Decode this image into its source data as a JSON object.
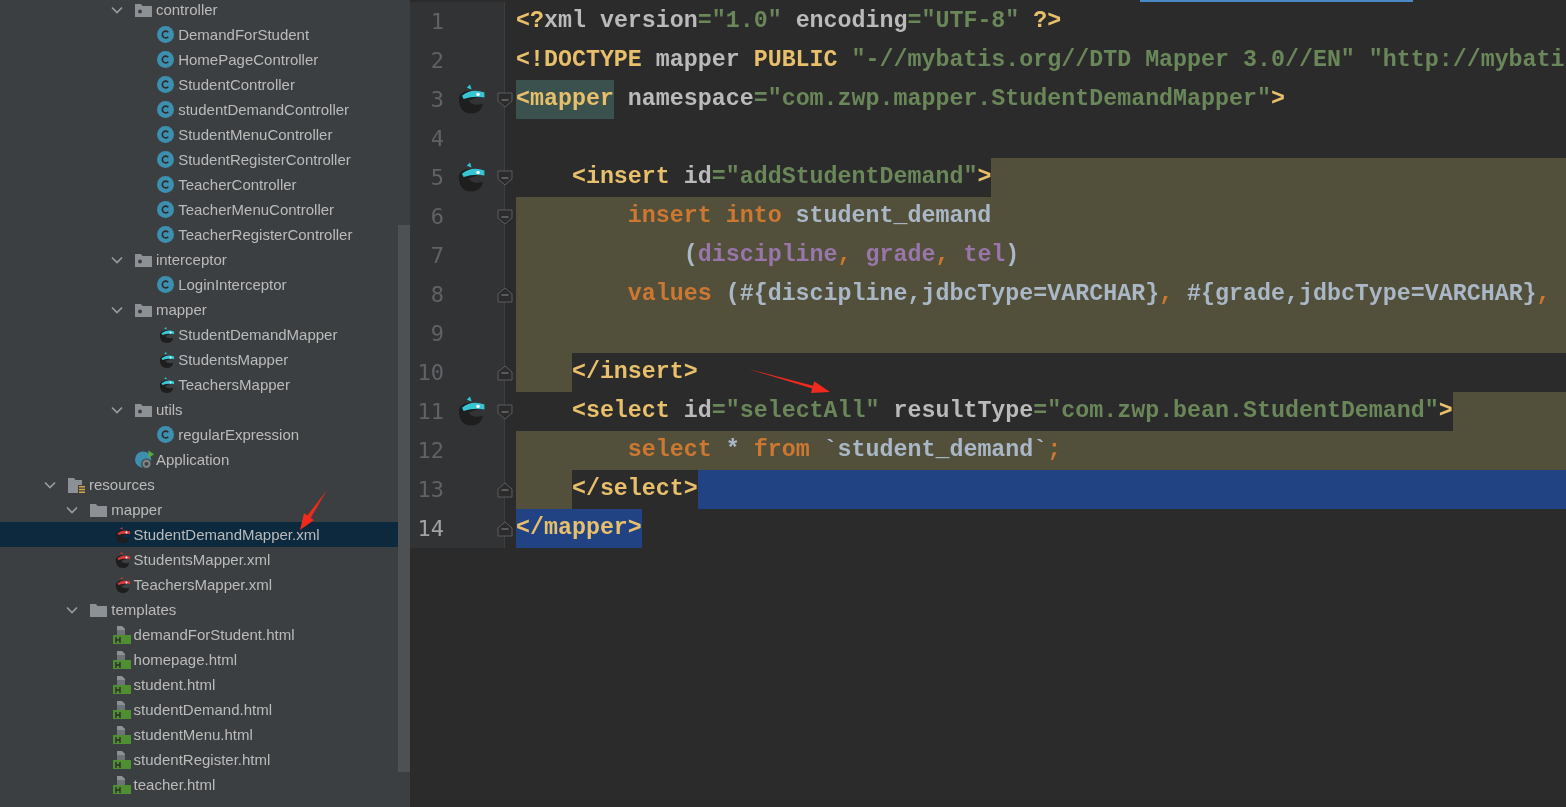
{
  "project_tree": [
    {
      "children": [
        {
          "children": [
            {
              "children": [
                {
                  "label": "controller",
                  "kind": "package",
                  "expanded": true,
                  "selected": false,
                  "children": [
                    {
                      "label": "DemandForStudent",
                      "kind": "class",
                      "selected": false
                    },
                    {
                      "label": "HomePageController",
                      "kind": "class",
                      "selected": false
                    },
                    {
                      "label": "StudentController",
                      "kind": "class",
                      "selected": false
                    },
                    {
                      "label": "studentDemandController",
                      "kind": "class",
                      "selected": false
                    },
                    {
                      "label": "StudentMenuController",
                      "kind": "class",
                      "selected": false
                    },
                    {
                      "label": "StudentRegisterController",
                      "kind": "class",
                      "selected": false
                    },
                    {
                      "label": "TeacherController",
                      "kind": "class",
                      "selected": false
                    },
                    {
                      "label": "TeacherMenuController",
                      "kind": "class",
                      "selected": false
                    },
                    {
                      "label": "TeacherRegisterController",
                      "kind": "class",
                      "selected": false
                    }
                  ]
                },
                {
                  "label": "interceptor",
                  "kind": "package",
                  "expanded": true,
                  "selected": false,
                  "children": [
                    {
                      "label": "LoginInterceptor",
                      "kind": "class",
                      "selected": false
                    }
                  ]
                },
                {
                  "label": "mapper",
                  "kind": "package",
                  "expanded": true,
                  "selected": false,
                  "children": [
                    {
                      "label": "StudentDemandMapper",
                      "kind": "mapper",
                      "selected": false
                    },
                    {
                      "label": "StudentsMapper",
                      "kind": "mapper",
                      "selected": false
                    },
                    {
                      "label": "TeachersMapper",
                      "kind": "mapper",
                      "selected": false
                    }
                  ]
                },
                {
                  "label": "utils",
                  "kind": "package",
                  "expanded": true,
                  "selected": false,
                  "children": [
                    {
                      "label": "regularExpression",
                      "kind": "class",
                      "selected": false
                    }
                  ]
                },
                {
                  "label": "Application",
                  "kind": "app",
                  "selected": false
                }
              ]
            }
          ]
        }
      ]
    },
    {
      "label": "resources",
      "kind": "resources",
      "expanded": true,
      "selected": false,
      "children": [
        {
          "label": "mapper",
          "kind": "folder",
          "expanded": true,
          "selected": false,
          "children": [
            {
              "label": "StudentDemandMapper.xml",
              "kind": "mapper_xml",
              "selected": true
            },
            {
              "label": "StudentsMapper.xml",
              "kind": "mapper_xml",
              "selected": false
            },
            {
              "label": "TeachersMapper.xml",
              "kind": "mapper_xml",
              "selected": false
            }
          ]
        },
        {
          "label": "templates",
          "kind": "folder",
          "expanded": true,
          "selected": false,
          "children": [
            {
              "label": "demandForStudent.html",
              "kind": "html",
              "selected": false
            },
            {
              "label": "homepage.html",
              "kind": "html",
              "selected": false
            },
            {
              "label": "student.html",
              "kind": "html",
              "selected": false
            },
            {
              "label": "studentDemand.html",
              "kind": "html",
              "selected": false
            },
            {
              "label": "studentMenu.html",
              "kind": "html",
              "selected": false
            },
            {
              "label": "studentRegister.html",
              "kind": "html",
              "selected": false
            },
            {
              "label": "teacher.html",
              "kind": "html",
              "selected": false
            }
          ]
        }
      ]
    }
  ],
  "code_lines": [
    {
      "number": "1",
      "current": false,
      "tokens": [
        {
          "text": "<?",
          "kind": "tag"
        },
        {
          "text": "xml",
          "kind": "attr"
        },
        {
          "text": " version",
          "kind": "attr"
        },
        {
          "text": "=\"1.0\"",
          "kind": "string"
        },
        {
          "text": " encoding",
          "kind": "attr"
        },
        {
          "text": "=\"UTF-8\"",
          "kind": "string"
        },
        {
          "text": " ?>",
          "kind": "tag"
        }
      ]
    },
    {
      "number": "2",
      "current": false,
      "tokens": [
        {
          "text": "<!DOCTYPE",
          "kind": "tag"
        },
        {
          "text": " mapper ",
          "kind": "attr"
        },
        {
          "text": "PUBLIC",
          "kind": "tag"
        },
        {
          "text": " \"-//mybatis.org//DTD Mapper 3.0//EN\" \"http://mybati",
          "kind": "string"
        }
      ]
    },
    {
      "number": "3",
      "mapper_icon": true,
      "fold_start": true,
      "current": false,
      "tokens": [
        {
          "text": "<mapper",
          "kind": "tag",
          "match": true
        },
        {
          "text": " namespace",
          "kind": "attr"
        },
        {
          "text": "=\"com.zwp.mapper.StudentDemandMapper\"",
          "kind": "string"
        },
        {
          "text": ">",
          "kind": "tag"
        }
      ]
    },
    {
      "number": "4",
      "current": false
    },
    {
      "number": "5",
      "mapper_icon": true,
      "fold_start": true,
      "current": false,
      "fill_highlight": true,
      "tokens": [
        {
          "text": "    <insert",
          "kind": "tag"
        },
        {
          "text": " id",
          "kind": "attr"
        },
        {
          "text": "=\"addStudentDemand\"",
          "kind": "string"
        },
        {
          "text": ">",
          "kind": "tag"
        }
      ]
    },
    {
      "number": "6",
      "fold_start": true,
      "current": false,
      "fill_highlight": true,
      "indent_highlight": true,
      "tokens": [
        {
          "text": "        insert into ",
          "kind": "keyword",
          "highlight": true
        },
        {
          "text": "student_demand",
          "kind": "plain",
          "highlight": true
        }
      ]
    },
    {
      "number": "7",
      "current": false,
      "fill_highlight": true,
      "indent_highlight": true,
      "tokens": [
        {
          "text": "            (",
          "kind": "plain",
          "highlight": true
        },
        {
          "text": "discipline",
          "kind": "column",
          "highlight": true
        },
        {
          "text": ", ",
          "kind": "keyword",
          "highlight": true
        },
        {
          "text": "grade",
          "kind": "column",
          "highlight": true
        },
        {
          "text": ", ",
          "kind": "keyword",
          "highlight": true
        },
        {
          "text": "tel",
          "kind": "column",
          "highlight": true
        },
        {
          "text": ")",
          "kind": "plain",
          "highlight": true
        }
      ]
    },
    {
      "number": "8",
      "fold_end": true,
      "current": false,
      "fill_highlight": true,
      "indent_highlight": true,
      "tokens": [
        {
          "text": "        values ",
          "kind": "keyword",
          "highlight": true
        },
        {
          "text": "(#{discipline,jdbcType=VARCHAR}",
          "kind": "plain",
          "highlight": true
        },
        {
          "text": ", ",
          "kind": "keyword",
          "highlight": true
        },
        {
          "text": "#{grade,jdbcType=VARCHAR}",
          "kind": "plain",
          "highlight": true
        },
        {
          "text": ",",
          "kind": "keyword",
          "highlight": true
        }
      ]
    },
    {
      "number": "9",
      "current": false,
      "fill_highlight": true
    },
    {
      "number": "10",
      "fold_end": true,
      "current": false,
      "indent_highlight": true,
      "tokens": [
        {
          "text": "    </insert>",
          "kind": "tag"
        }
      ]
    },
    {
      "number": "11",
      "mapper_icon": true,
      "fold_start": true,
      "current": false,
      "fill_highlight": true,
      "tokens": [
        {
          "text": "    <select",
          "kind": "tag"
        },
        {
          "text": " id",
          "kind": "attr"
        },
        {
          "text": "=\"selectAll\"",
          "kind": "string"
        },
        {
          "text": " resultType",
          "kind": "attr"
        },
        {
          "text": "=\"com.zwp.bean.StudentDemand\"",
          "kind": "string"
        },
        {
          "text": ">",
          "kind": "tag"
        }
      ]
    },
    {
      "number": "12",
      "current": false,
      "fill_highlight": true,
      "indent_highlight": true,
      "tokens": [
        {
          "text": "        select ",
          "kind": "keyword",
          "highlight": true
        },
        {
          "text": "* ",
          "kind": "plain",
          "highlight": true
        },
        {
          "text": "from ",
          "kind": "keyword",
          "highlight": true
        },
        {
          "text": "`student_demand`",
          "kind": "plain",
          "highlight": true
        },
        {
          "text": ";",
          "kind": "keyword",
          "highlight": true
        }
      ]
    },
    {
      "number": "13",
      "fold_end": true,
      "current": false,
      "fill_selected": true,
      "indent_highlight": true,
      "tokens": [
        {
          "text": "    </select>",
          "kind": "tag"
        }
      ]
    },
    {
      "number": "14",
      "fold_end": true,
      "current": true,
      "tokens": [
        {
          "text": "</mapper>",
          "kind": "tag",
          "selected": true
        }
      ]
    }
  ]
}
